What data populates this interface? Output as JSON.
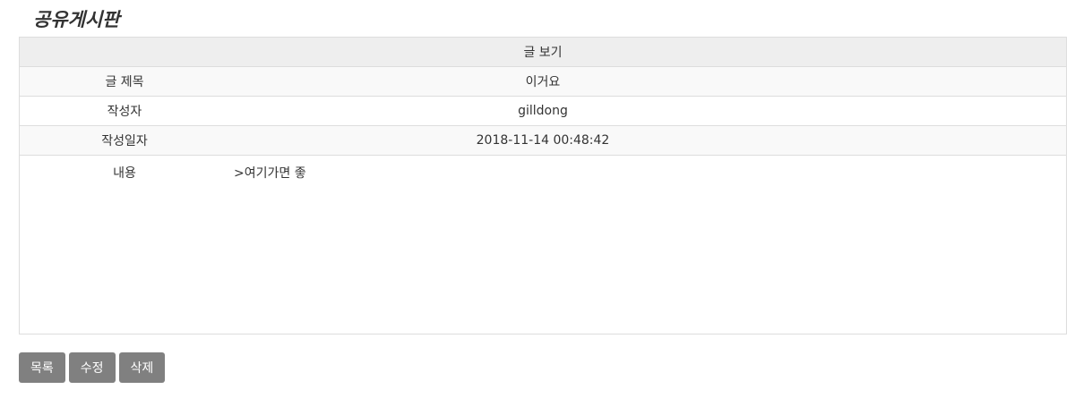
{
  "board": {
    "title": "공유게시판"
  },
  "post": {
    "header": "글 보기",
    "fields": [
      {
        "label": "글 제목",
        "value": "이거요"
      },
      {
        "label": "작성자",
        "value": "gilldong"
      },
      {
        "label": "작성일자",
        "value": "2018-11-14 00:48:42"
      }
    ],
    "content_label": "내용",
    "content_value": ">여기가면 좋"
  },
  "buttons": {
    "list_label": "목록",
    "edit_label": "수정",
    "delete_label": "삭제"
  }
}
